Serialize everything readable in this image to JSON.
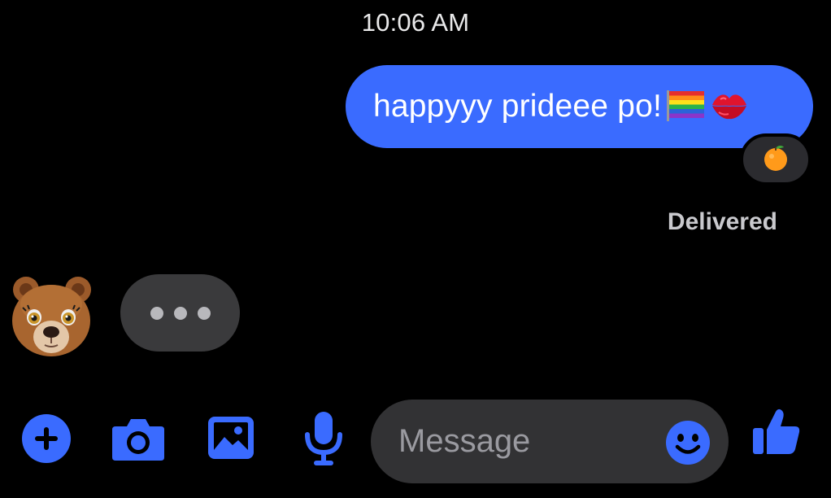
{
  "chat": {
    "timestamp": "10:06 AM",
    "outgoing_message": {
      "text": "happyyy prideee po!",
      "emojis": [
        "rainbow-flag",
        "kiss-mark"
      ],
      "reaction": "tangerine"
    },
    "status": "Delivered",
    "incoming": {
      "avatar": "bear-memoji",
      "typing_indicator": true
    }
  },
  "composer": {
    "placeholder": "Message",
    "buttons": [
      "plus-icon",
      "camera-icon",
      "gallery-icon",
      "microphone-icon",
      "emoji-icon",
      "thumbs-up-icon"
    ]
  },
  "colors": {
    "accent": "#3a6bff",
    "background": "#000000",
    "bubble_incoming": "#3a3a3c",
    "field": "#323234"
  }
}
